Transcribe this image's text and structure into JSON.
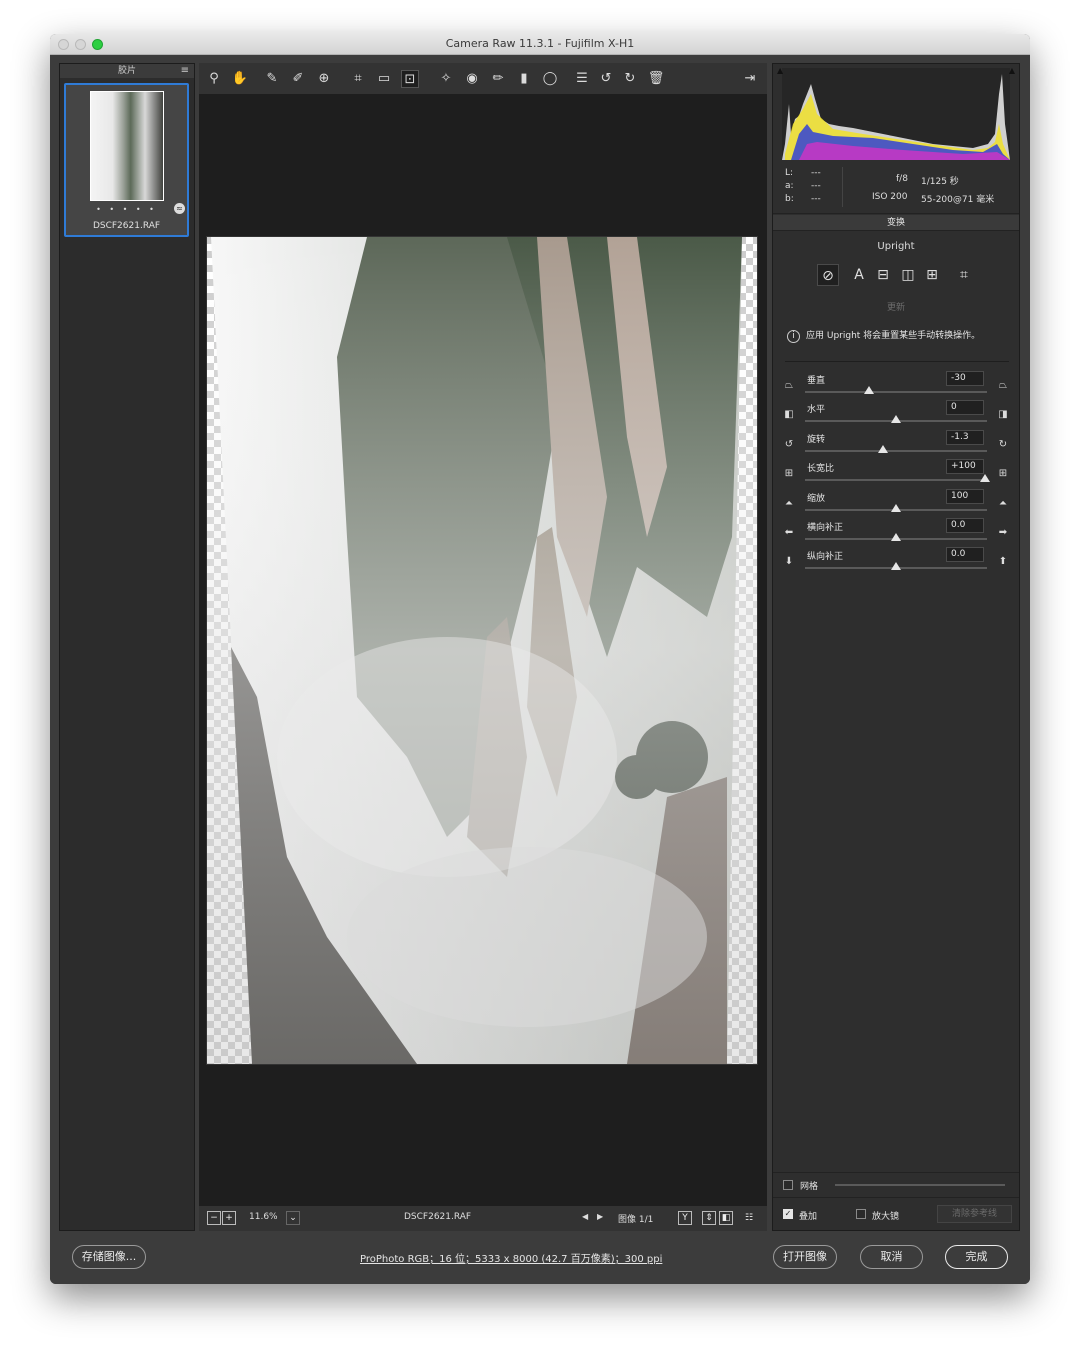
{
  "window": {
    "title": "Camera Raw 11.3.1 -  Fujifilm X-H1"
  },
  "filmstrip": {
    "header": "胶片",
    "menu_icon": "≡",
    "thumbnail": {
      "dots": "• • • • •",
      "filename": "DSCF2621.RAF",
      "badge_icon": "≈"
    }
  },
  "toolbar": {
    "tools": [
      {
        "name": "zoom-tool-icon",
        "glyph": "⚲"
      },
      {
        "name": "hand-tool-icon",
        "glyph": "✋"
      },
      {
        "name": "white-balance-tool-icon",
        "glyph": "✎"
      },
      {
        "name": "color-sampler-tool-icon",
        "glyph": "✐"
      },
      {
        "name": "targeted-adjustment-tool-icon",
        "glyph": "⊕"
      },
      {
        "name": "crop-tool-icon",
        "glyph": "⌗"
      },
      {
        "name": "straighten-tool-icon",
        "glyph": "▭"
      },
      {
        "name": "transform-tool-icon",
        "glyph": "⊡"
      },
      {
        "name": "spot-removal-tool-icon",
        "glyph": "✧"
      },
      {
        "name": "red-eye-tool-icon",
        "glyph": "◉"
      },
      {
        "name": "adjustment-brush-icon",
        "glyph": "✏"
      },
      {
        "name": "graduated-filter-icon",
        "glyph": "▮"
      },
      {
        "name": "radial-filter-icon",
        "glyph": "◯"
      },
      {
        "name": "preferences-icon",
        "glyph": "☰"
      },
      {
        "name": "rotate-left-icon",
        "glyph": "↺"
      },
      {
        "name": "rotate-right-icon",
        "glyph": "↻"
      },
      {
        "name": "delete-icon",
        "glyph": "🗑"
      }
    ],
    "export_icon": "⇥"
  },
  "preview": {
    "zoom_minus": "−",
    "zoom_plus": "+",
    "zoom": "11.6%",
    "zoom_dropdown_icon": "⌄",
    "filename": "DSCF2621.RAF",
    "prev_icon": "◀",
    "next_icon": "▶",
    "image_counter": "图像 1/1",
    "view_buttons": [
      "Y",
      "⇕",
      "◧",
      "☷"
    ]
  },
  "histogram": {
    "clip_left_icon": "▲",
    "clip_right_icon": "▲",
    "lab": {
      "l": "L:",
      "a": "a:",
      "b": "b:",
      "l_val": "---",
      "a_val": "---",
      "b_val": "---"
    },
    "camera": {
      "aperture": "f/8",
      "shutter": "1/125 秒",
      "iso": "ISO 200",
      "lens": "55-200@71 毫米"
    }
  },
  "transform": {
    "section_title": "变换",
    "upright_label": "Upright",
    "upright_buttons": [
      {
        "name": "upright-off-icon",
        "glyph": "⊘"
      },
      {
        "name": "upright-auto-icon",
        "glyph": "A"
      },
      {
        "name": "upright-level-icon",
        "glyph": "⊟"
      },
      {
        "name": "upright-vertical-icon",
        "glyph": "◫"
      },
      {
        "name": "upright-full-icon",
        "glyph": "⊞"
      },
      {
        "name": "upright-guided-icon",
        "glyph": "⌗"
      }
    ],
    "update_label": "更新",
    "info_icon": "i",
    "info_text": "应用 Upright 将会重置某些手动转换操作。",
    "sliders": [
      {
        "label": "垂直",
        "value": "-30",
        "pos": 0.35,
        "left_icon": "⏢",
        "right_icon": "⏢"
      },
      {
        "label": "水平",
        "value": "0",
        "pos": 0.5,
        "left_icon": "◧",
        "right_icon": "◨"
      },
      {
        "label": "旋转",
        "value": "-1.3",
        "pos": 0.43,
        "left_icon": "↺",
        "right_icon": "↻"
      },
      {
        "label": "长宽比",
        "value": "+100",
        "pos": 0.99,
        "left_icon": "⊞",
        "right_icon": "⊞"
      },
      {
        "label": "缩放",
        "value": "100",
        "pos": 0.5,
        "left_icon": "⏶",
        "right_icon": "⏶"
      },
      {
        "label": "横向补正",
        "value": "0.0",
        "pos": 0.5,
        "left_icon": "⬅",
        "right_icon": "➡"
      },
      {
        "label": "纵向补正",
        "value": "0.0",
        "pos": 0.5,
        "left_icon": "⬇",
        "right_icon": "⬆"
      }
    ],
    "grid_label": "网格",
    "overlay_label": "叠加",
    "loupe_label": "放大镜",
    "clear_guides_label": "清除参考线",
    "checkmark": "✓"
  },
  "footer": {
    "save_label": "存储图像...",
    "workflow_text": "ProPhoto RGB；16 位；5333 x 8000 (42.7 百万像素)；300 ppi",
    "open_label": "打开图像",
    "cancel_label": "取消",
    "done_label": "完成"
  }
}
